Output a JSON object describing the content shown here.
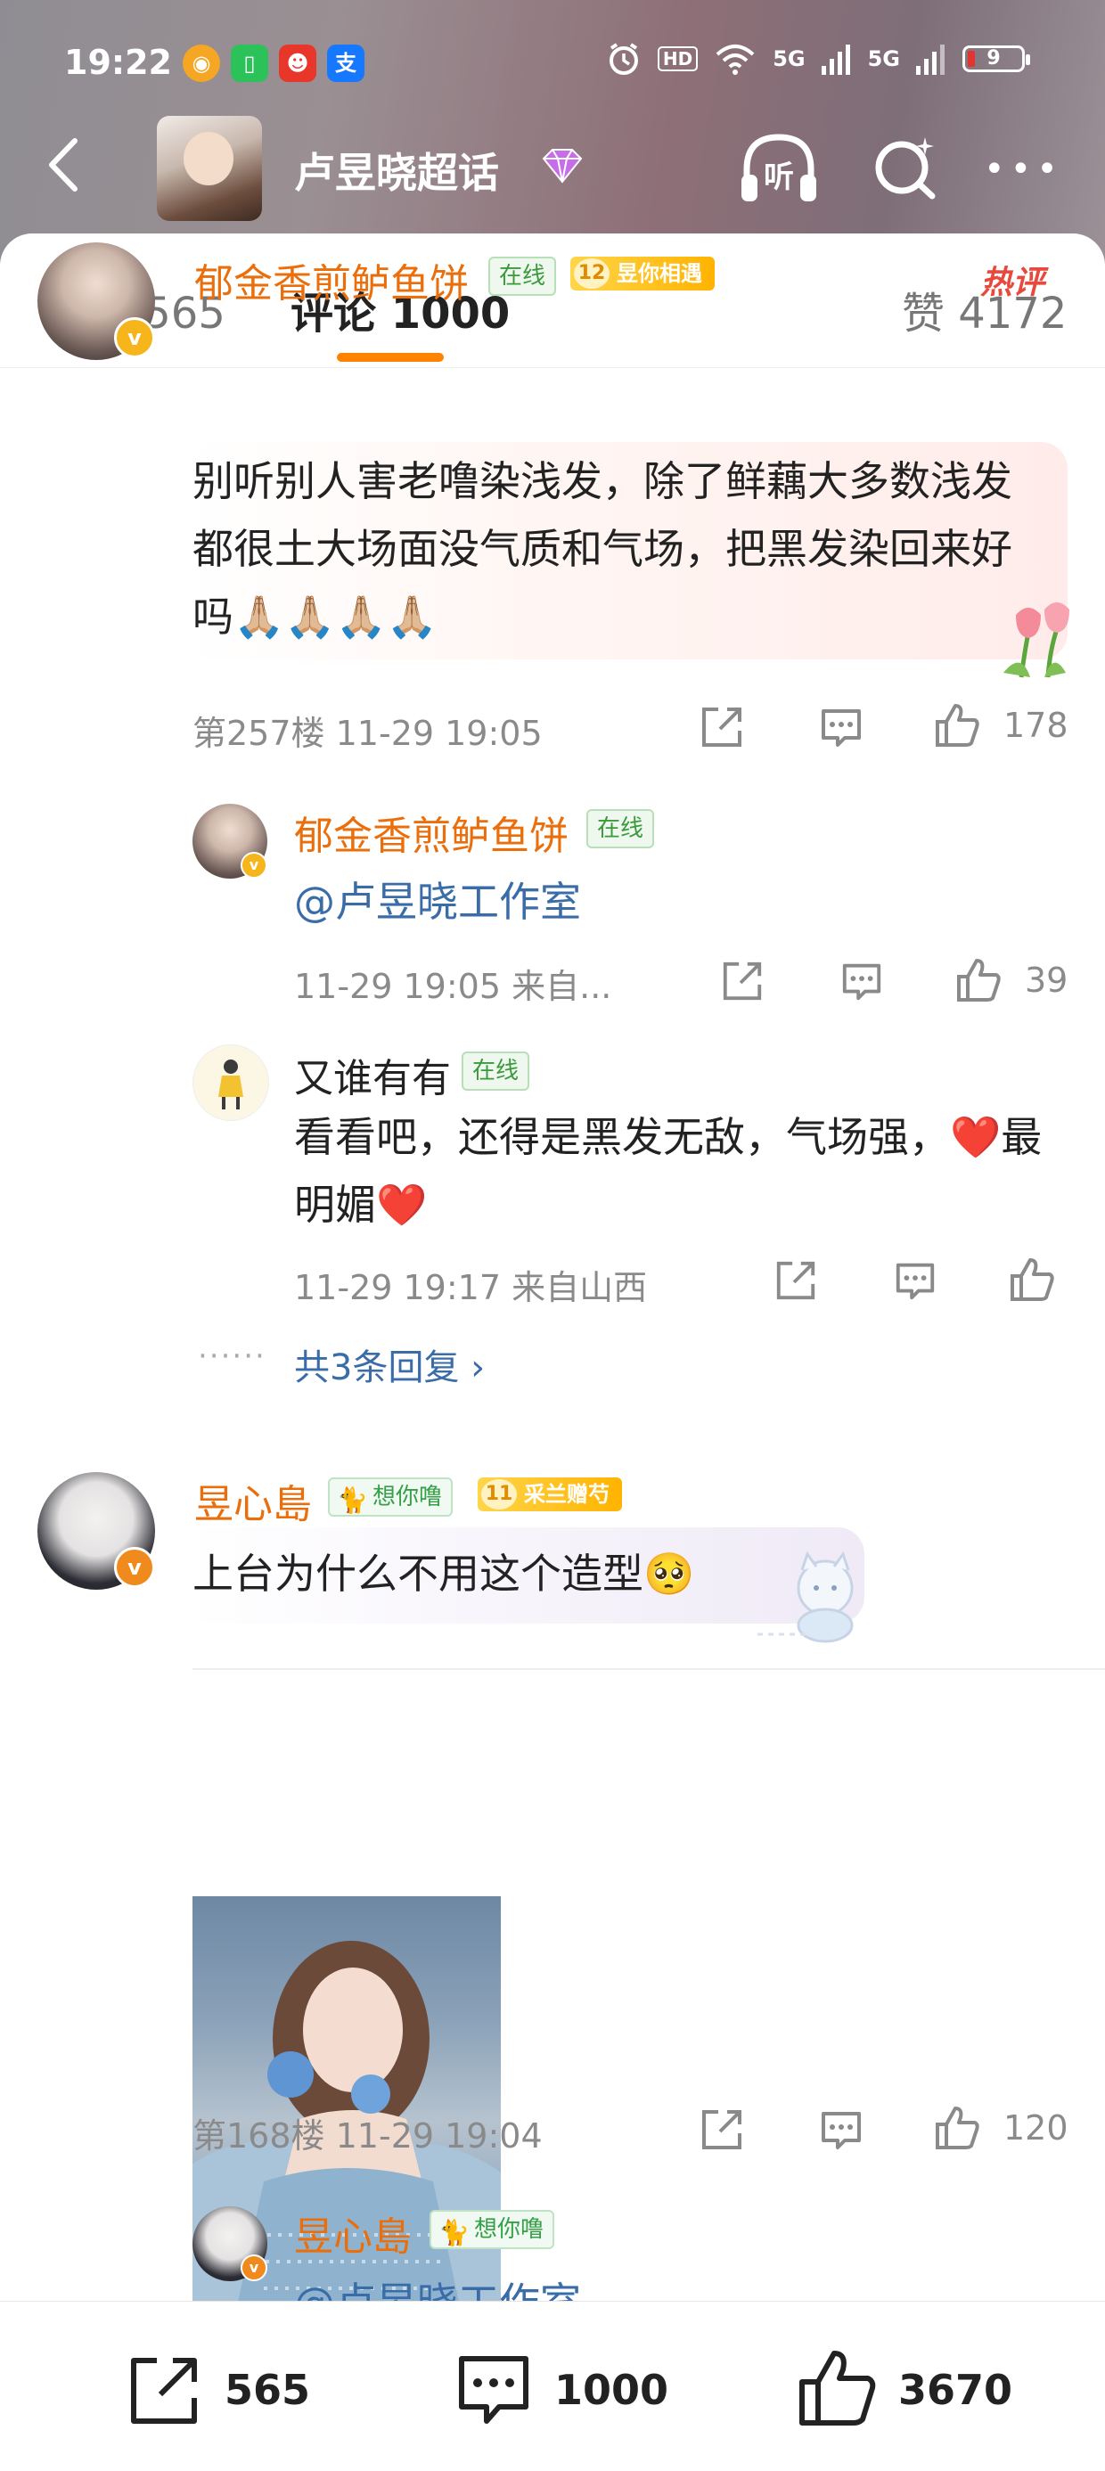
{
  "status_bar": {
    "time": "19:22",
    "hd": "HD",
    "net1": "5G",
    "net2": "5G",
    "battery": "9"
  },
  "nav": {
    "title": "卢昱晓超话"
  },
  "tabs": {
    "repost": "转发 565",
    "comments": "评论 1000",
    "likes": "赞 4172"
  },
  "comments": [
    {
      "user": "郁金香煎鲈鱼饼",
      "online_tag": "在线",
      "fan_level": "12",
      "fan_tag": "昱你相遇",
      "hot_label": "热评",
      "text": "别听别人害老噜染浅发，除了鲜藕大多数浅发都很土大场面没气质和气场，把黑发染回来好吗🙏🏼🙏🏼🙏🏼🙏🏼",
      "floor": "第257楼",
      "time": "11-29 19:05",
      "likes": "178",
      "replies": [
        {
          "user": "郁金香煎鲈鱼饼",
          "online_tag": "在线",
          "text": "@卢昱晓工作室",
          "time": "11-29 19:05",
          "source": "来自...",
          "likes": "39"
        },
        {
          "user": "又谁有有",
          "online_tag": "在线",
          "text": "看看吧，还得是黑发无敌，气场强，❤️最明媚❤️",
          "time": "11-29 19:17",
          "source": "来自山西",
          "likes": ""
        }
      ],
      "more_replies": "共3条回复 ›",
      "dots": "······"
    },
    {
      "user": "昱心島",
      "cat_tag": "想你噜",
      "fan_level": "11",
      "fan_tag": "采兰赠芍",
      "text": "上台为什么不用这个造型🥺",
      "floor": "第168楼",
      "time": "11-29 19:04",
      "likes": "120",
      "replies": [
        {
          "user": "昱心島",
          "cat_tag": "想你噜",
          "text": "@卢昱晓工作室"
        }
      ]
    }
  ],
  "bottom_bar": {
    "repost_count": "565",
    "comment_count": "1000",
    "like_count": "3670"
  },
  "colors": {
    "username": "#ea6f0c",
    "link": "#3a6ca8",
    "accent": "#ff8200",
    "hot": "#e8493d"
  }
}
